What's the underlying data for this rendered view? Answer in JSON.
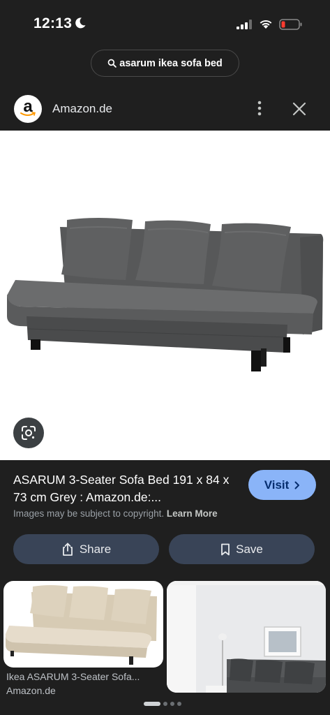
{
  "status_bar": {
    "time": "12:13"
  },
  "search": {
    "query": "asarum ikea sofa bed"
  },
  "source": {
    "name": "Amazon.de",
    "logo_letter": "a"
  },
  "product": {
    "title": "ASARUM 3-Seater Sofa Bed 191 x 84 x 73 cm Grey : Amazon.de:...",
    "visit_label": "Visit"
  },
  "copyright": {
    "text": "Images may be subject to copyright.",
    "learn_more": "Learn More"
  },
  "actions": {
    "share_label": "Share",
    "save_label": "Save"
  },
  "related": [
    {
      "title": "Ikea ASARUM 3-Seater Sofa...",
      "source": "Amazon.de"
    }
  ],
  "colors": {
    "background": "#1f1f1f",
    "visit_button": "#8ab4f8",
    "action_button": "#394457",
    "battery_low": "#ff3b30"
  },
  "pager": {
    "total": 4,
    "active": 1
  }
}
